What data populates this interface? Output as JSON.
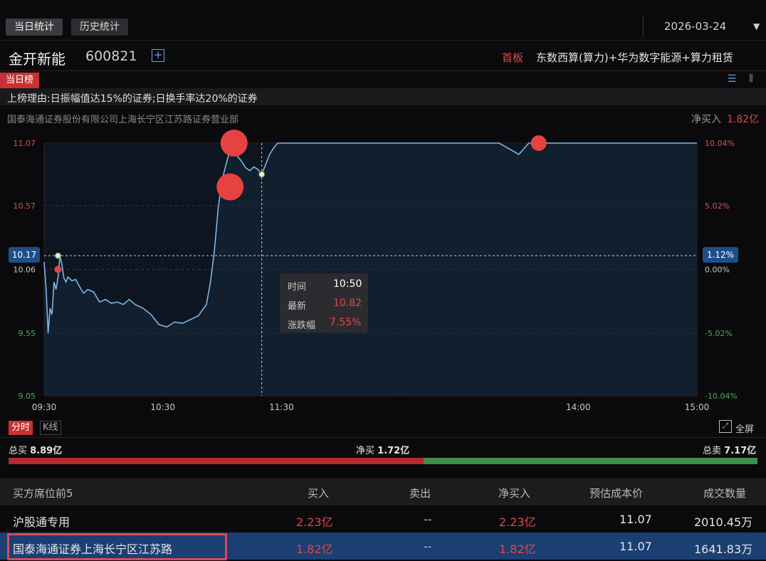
{
  "tabs": [
    {
      "label": "当日统计",
      "active": true
    },
    {
      "label": "历史统计",
      "active": false
    }
  ],
  "date": "2026-03-24",
  "stock": {
    "name": "金开新能",
    "code": "600821",
    "board": "首板",
    "concepts": "东数西算(算力)+华为数字能源+算力租赁"
  },
  "list_tab": "当日榜",
  "reason": "上榜理由:日振幅值达15%的证券;日换手率达20%的证券",
  "broker": {
    "name": "国泰海通证券股份有限公司上海长宁区江苏路证券营业部",
    "net_label": "净买入",
    "net_value": "1.82亿"
  },
  "tooltip": {
    "time_label": "时间",
    "time_value": "10:50",
    "price_label": "最新",
    "price_value": "10.82",
    "change_label": "涨跌幅",
    "change_value": "7.55%"
  },
  "crosshair": {
    "price": "10.17",
    "pct": "1.12%"
  },
  "chart_tabs": [
    {
      "label": "分时",
      "active": true
    },
    {
      "label": "K线",
      "active": false
    }
  ],
  "fullscreen_label": "全屏",
  "summary": {
    "buy_label": "总买",
    "buy_value": "8.89亿",
    "net_label": "净买",
    "net_value": "1.72亿",
    "sell_label": "总卖",
    "sell_value": "7.17亿",
    "buy_ratio": 0.554
  },
  "table": {
    "headers": [
      "买方席位前5",
      "买入",
      "卖出",
      "净买入",
      "预估成本价",
      "成交数量"
    ],
    "rows": [
      [
        "沪股通专用",
        "2.23亿",
        "--",
        "2.23亿",
        "11.07",
        "2010.45万"
      ],
      [
        "国泰海通证券上海长宁区江苏路",
        "1.82亿",
        "--",
        "1.82亿",
        "11.07",
        "1641.83万"
      ]
    ]
  },
  "colors": {
    "up": "#e04848",
    "down": "#3f8e48",
    "line": "#7fb6e6",
    "highlight": "#1b3f72"
  },
  "chart_data": {
    "type": "line",
    "y_left_ticks": [
      "11.07",
      "10.57",
      "10.06",
      "9.55",
      "9.05"
    ],
    "y_right_ticks": [
      "10.04%",
      "5.02%",
      "0.00%",
      "-5.02%",
      "-10.04%"
    ],
    "x_ticks": [
      "09:30",
      "10:30",
      "11:30",
      "14:00",
      "15:00"
    ],
    "ylim": [
      9.05,
      11.07
    ],
    "prev_close": 10.06,
    "series": [
      {
        "x": [
          0,
          1,
          2,
          3,
          4,
          5,
          6,
          7,
          8,
          9,
          10,
          11,
          12,
          14,
          16,
          18,
          20,
          22,
          25,
          28,
          31,
          34,
          37,
          40,
          43,
          46,
          50,
          54,
          58,
          62,
          66,
          70,
          74,
          78,
          82,
          84,
          86,
          88,
          90,
          92,
          94,
          96,
          98,
          100,
          102,
          104,
          106,
          108,
          110,
          112,
          114,
          116,
          118,
          120,
          124,
          128,
          130,
          135,
          140,
          145,
          150,
          160,
          180,
          200,
          230,
          240,
          245,
          250,
          255,
          260,
          265,
          270,
          290,
          330
        ],
        "y": [
          10.12,
          9.9,
          9.55,
          9.75,
          9.7,
          9.96,
          9.9,
          10.0,
          10.17,
          10.1,
          9.99,
          9.96,
          10.0,
          9.97,
          9.98,
          9.92,
          9.87,
          9.9,
          9.88,
          9.8,
          9.82,
          9.79,
          9.8,
          9.78,
          9.82,
          9.78,
          9.75,
          9.7,
          9.62,
          9.6,
          9.64,
          9.63,
          9.66,
          9.69,
          9.78,
          9.95,
          10.2,
          10.55,
          10.78,
          10.9,
          11.02,
          11.07,
          10.96,
          10.92,
          10.87,
          10.85,
          10.88,
          10.86,
          10.82,
          10.9,
          10.98,
          11.03,
          11.07,
          11.07,
          11.07,
          11.07,
          11.07,
          11.07,
          11.07,
          11.07,
          11.07,
          11.07,
          11.07,
          11.07,
          11.07,
          10.98,
          11.07,
          11.07,
          11.07,
          11.07,
          11.07,
          11.07,
          11.07,
          11.07
        ]
      }
    ],
    "markers": [
      {
        "x": 7,
        "y": 10.17,
        "kind": "point"
      },
      {
        "x": 7,
        "y": 10.06,
        "kind": "small-dot"
      },
      {
        "x": 96,
        "y": 11.07,
        "kind": "big-dot"
      },
      {
        "x": 94,
        "y": 10.72,
        "kind": "big-dot"
      },
      {
        "x": 110,
        "y": 10.82,
        "kind": "point"
      },
      {
        "x": 250,
        "y": 11.07,
        "kind": "mid-dot"
      }
    ],
    "cursor": {
      "x": 110,
      "y": 10.17
    }
  }
}
